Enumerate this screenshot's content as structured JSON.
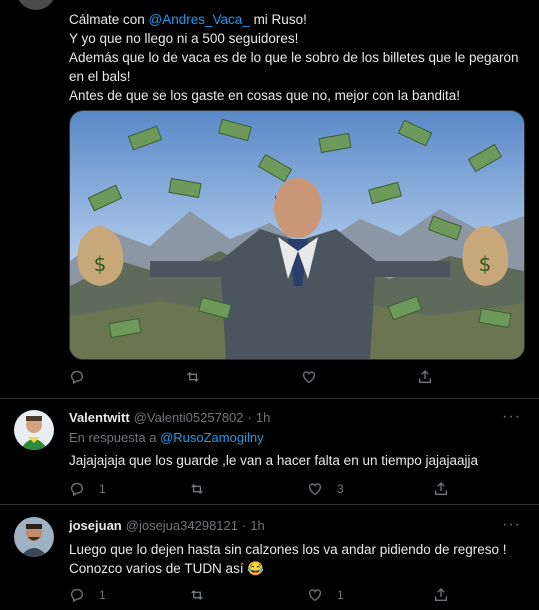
{
  "tweet": {
    "line1_pre": "Cálmate con ",
    "line1_mention": "@Andres_Vaca_",
    "line1_post": " mi Ruso!",
    "line2": "Y yo que no llego ni a 500 seguidores!",
    "line3": "Además que lo de vaca es de lo que le sobro de los billetes que le pegaron en el bals!",
    "line4": "Antes de que se los gaste en cosas que no, mejor con la bandita!"
  },
  "replies": [
    {
      "name": "Valentwitt",
      "handle": "@Valenti05257802",
      "dot": "·",
      "time": "1h",
      "reply_to_label": "En respuesta a ",
      "reply_to_mention": "@RusoZamogilny",
      "text": "Jajajajaja que los guarde ,le van a hacer falta en un tiempo jajajaajja",
      "reply_count": "1",
      "retweet_count": "",
      "like_count": "3"
    },
    {
      "name": "josejuan",
      "handle": "@josejua34298121",
      "dot": "·",
      "time": "1h",
      "text_line1": "Luego que lo dejen hasta sin calzones los va andar pidiendo de regreso !",
      "text_line2": "Conozco varios de TUDN así",
      "emoji": "😂",
      "reply_count": "1",
      "retweet_count": "",
      "like_count": "1"
    }
  ],
  "more_label": "···",
  "icons": [
    "reply-icon",
    "retweet-icon",
    "like-icon",
    "share-icon",
    "more-icon",
    "dollar-bag-icon"
  ],
  "colors": {
    "background": "#000000",
    "text": "#e7e9ea",
    "secondary": "#71767b",
    "accent": "#1d9bf0",
    "divider": "#2f3336"
  }
}
